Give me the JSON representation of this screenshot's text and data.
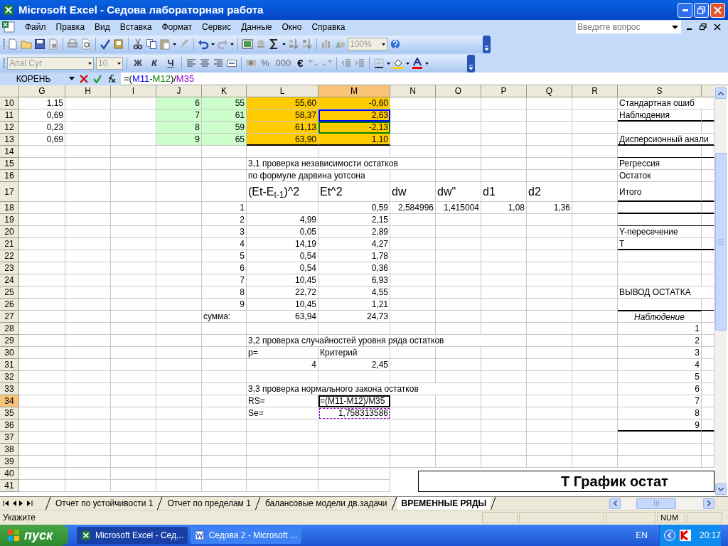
{
  "window": {
    "title": "Microsoft Excel - Седова лабораторная работа"
  },
  "menu": [
    "Файл",
    "Правка",
    "Вид",
    "Вставка",
    "Формат",
    "Сервис",
    "Данные",
    "Окно",
    "Справка"
  ],
  "help_box": {
    "placeholder": "Введите вопрос"
  },
  "standard_toolbar": {
    "zoom": "100%"
  },
  "formatting_toolbar": {
    "font": "Arial Cyr",
    "size": "10",
    "style_buttons": [
      "Ж",
      "К",
      "Ч"
    ],
    "number_buttons": [
      "%",
      "000",
      "€"
    ]
  },
  "formula_bar": {
    "name_box": "КОРЕНЬ",
    "formula": [
      {
        "text": "=("
      },
      {
        "text": "M11",
        "color": "#0000ff"
      },
      {
        "text": "-"
      },
      {
        "text": "M12",
        "color": "#008000"
      },
      {
        "text": ")/"
      },
      {
        "text": "M35",
        "color": "#9900cc"
      }
    ]
  },
  "columns": [
    {
      "label": "G",
      "selected": false
    },
    {
      "label": "H",
      "selected": false
    },
    {
      "label": "I",
      "selected": false
    },
    {
      "label": "J",
      "selected": false
    },
    {
      "label": "K",
      "selected": false
    },
    {
      "label": "L",
      "selected": false
    },
    {
      "label": "M",
      "selected": true
    },
    {
      "label": "N",
      "selected": false
    },
    {
      "label": "O",
      "selected": false
    },
    {
      "label": "P",
      "selected": false
    },
    {
      "label": "Q",
      "selected": false
    },
    {
      "label": "R",
      "selected": false
    },
    {
      "label": "S",
      "selected": false
    }
  ],
  "rows": [
    {
      "label": "10",
      "selected": false,
      "cells": {
        "G": {
          "text": "1,15",
          "kind": "number"
        },
        "J": {
          "text": "6",
          "kind": "number",
          "color": "#ccffcc"
        },
        "K": {
          "text": "55",
          "kind": "number",
          "color": "#ccffcc"
        },
        "L": {
          "text": "55,60",
          "kind": "number",
          "color": "#ffcc00"
        },
        "M": {
          "text": "-0,60",
          "kind": "number",
          "color": "#ffcc00"
        },
        "S": {
          "text": "Стандартная ошиб",
          "kind": "text"
        }
      }
    },
    {
      "label": "11",
      "selected": false,
      "cells": {
        "G": {
          "text": "0,69",
          "kind": "number"
        },
        "J": {
          "text": "7",
          "kind": "number",
          "color": "#ccffcc"
        },
        "K": {
          "text": "61",
          "kind": "number",
          "color": "#ccffcc"
        },
        "L": {
          "text": "58,37",
          "kind": "number",
          "color": "#ffcc00"
        },
        "M": {
          "text": "2,63",
          "kind": "number",
          "color": "#ffcc00",
          "reference": {
            "color": "#0000ff",
            "dashed": false
          }
        },
        "S": {
          "text": "Наблюдения",
          "kind": "text",
          "border_below": true,
          "heavy": true
        }
      }
    },
    {
      "label": "12",
      "selected": false,
      "cells": {
        "G": {
          "text": "0,23",
          "kind": "number"
        },
        "J": {
          "text": "8",
          "kind": "number",
          "color": "#ccffcc"
        },
        "K": {
          "text": "59",
          "kind": "number",
          "color": "#ccffcc"
        },
        "L": {
          "text": "61,13",
          "kind": "number",
          "color": "#ffcc00"
        },
        "M": {
          "text": "-2,13",
          "kind": "number",
          "color": "#ffcc00",
          "reference": {
            "color": "#008000",
            "dashed": false
          }
        }
      }
    },
    {
      "label": "13",
      "selected": false,
      "cells": {
        "G": {
          "text": "0,69",
          "kind": "number"
        },
        "J": {
          "text": "9",
          "kind": "number",
          "color": "#ccffcc"
        },
        "K": {
          "text": "65",
          "kind": "number",
          "color": "#ccffcc"
        },
        "L": {
          "text": "63,90",
          "kind": "number",
          "color": "#ffcc00",
          "border_below": true,
          "heavy": true
        },
        "M": {
          "text": "1,10",
          "kind": "number",
          "color": "#ffcc00",
          "border_below": true,
          "heavy": true
        },
        "S": {
          "text": "Дисперсионный анали",
          "kind": "text",
          "border_below": true,
          "heavy": true
        }
      }
    },
    {
      "label": "14",
      "selected": false,
      "cells": {
        "S": {
          "border_below": true,
          "heavy": false
        }
      }
    },
    {
      "label": "15",
      "selected": false,
      "cells": {
        "L": {
          "text": "3,1 проверка независимости остатков",
          "kind": "text"
        },
        "S": {
          "text": "Регрессия",
          "kind": "text"
        }
      }
    },
    {
      "label": "16",
      "selected": false,
      "cells": {
        "L": {
          "text": "по формуле дарвина уотсона",
          "kind": "text"
        },
        "S": {
          "text": "Остаток",
          "kind": "text"
        }
      }
    },
    {
      "label": "17",
      "selected": false,
      "cells": {
        "L": {
          "text": "(Et-E$_{t-1}$)^2",
          "kind": "heading"
        },
        "M": {
          "text": "Et^2",
          "kind": "heading"
        },
        "N": {
          "text": "dw",
          "kind": "heading"
        },
        "O": {
          "text": "dw\"",
          "kind": "heading"
        },
        "P": {
          "text": "d1",
          "kind": "heading"
        },
        "Q": {
          "text": "d2",
          "kind": "heading"
        },
        "S": {
          "text": "Итого",
          "kind": "text",
          "border_below": true,
          "heavy": true
        }
      }
    },
    {
      "label": "18",
      "selected": false,
      "cells": {
        "K": {
          "text": "1",
          "kind": "number"
        },
        "M": {
          "text": "0,59",
          "kind": "number"
        },
        "N": {
          "text": "2,584996",
          "kind": "number"
        },
        "O": {
          "text": "1,415004",
          "kind": "number"
        },
        "P": {
          "text": "1,08",
          "kind": "number"
        },
        "Q": {
          "text": "1,36",
          "kind": "number"
        },
        "S": {
          "border_below": true,
          "heavy": true
        }
      }
    },
    {
      "label": "19",
      "selected": false,
      "cells": {
        "K": {
          "text": "2",
          "kind": "number"
        },
        "L": {
          "text": "4,99",
          "kind": "number"
        },
        "M": {
          "text": "2,15",
          "kind": "number"
        },
        "S": {
          "border_below": true,
          "heavy": false
        }
      }
    },
    {
      "label": "20",
      "selected": false,
      "cells": {
        "K": {
          "text": "3",
          "kind": "number"
        },
        "L": {
          "text": "0,05",
          "kind": "number"
        },
        "M": {
          "text": "2,89",
          "kind": "number"
        },
        "S": {
          "text": "Y-пересечение",
          "kind": "text"
        }
      }
    },
    {
      "label": "21",
      "selected": false,
      "cells": {
        "K": {
          "text": "4",
          "kind": "number"
        },
        "L": {
          "text": "14,19",
          "kind": "number"
        },
        "M": {
          "text": "4,27",
          "kind": "number"
        },
        "S": {
          "text": "T",
          "kind": "text",
          "border_below": true,
          "heavy": true
        }
      }
    },
    {
      "label": "22",
      "selected": false,
      "cells": {
        "K": {
          "text": "5",
          "kind": "number"
        },
        "L": {
          "text": "0,54",
          "kind": "number"
        },
        "M": {
          "text": "1,78",
          "kind": "number"
        }
      }
    },
    {
      "label": "23",
      "selected": false,
      "cells": {
        "K": {
          "text": "6",
          "kind": "number"
        },
        "L": {
          "text": "0,54",
          "kind": "number"
        },
        "M": {
          "text": "0,36",
          "kind": "number"
        }
      }
    },
    {
      "label": "24",
      "selected": false,
      "cells": {
        "K": {
          "text": "7",
          "kind": "number"
        },
        "L": {
          "text": "10,45",
          "kind": "number"
        },
        "M": {
          "text": "6,93",
          "kind": "number"
        }
      }
    },
    {
      "label": "25",
      "selected": false,
      "cells": {
        "K": {
          "text": "8",
          "kind": "number"
        },
        "L": {
          "text": "22,72",
          "kind": "number"
        },
        "M": {
          "text": "4,55",
          "kind": "number"
        },
        "S": {
          "text": "ВЫВОД ОСТАТКА",
          "kind": "text"
        }
      }
    },
    {
      "label": "26",
      "selected": false,
      "cells": {
        "K": {
          "text": "9",
          "kind": "number"
        },
        "L": {
          "text": "10,45",
          "kind": "number"
        },
        "M": {
          "text": "1,21",
          "kind": "number"
        },
        "S": {
          "border_below": true,
          "heavy": false
        }
      }
    },
    {
      "label": "27",
      "selected": false,
      "cells": {
        "K": {
          "text": "сумма:",
          "kind": "text"
        },
        "L": {
          "text": "63,94",
          "kind": "number"
        },
        "M": {
          "text": "24,73",
          "kind": "number"
        },
        "S": {
          "text": "Наблюдение",
          "kind": "caption"
        }
      }
    },
    {
      "label": "28",
      "selected": false,
      "cells": {
        "S": {
          "text": "1",
          "kind": "number"
        }
      }
    },
    {
      "label": "29",
      "selected": false,
      "cells": {
        "L": {
          "text": "3,2 проверка случайностей уровня ряда остатков",
          "kind": "text"
        },
        "S": {
          "text": "2",
          "kind": "number"
        }
      }
    },
    {
      "label": "30",
      "selected": false,
      "cells": {
        "L": {
          "text": "p=",
          "kind": "text"
        },
        "M": {
          "text": "Критерий",
          "kind": "text"
        },
        "S": {
          "text": "3",
          "kind": "number"
        }
      }
    },
    {
      "label": "31",
      "selected": false,
      "cells": {
        "L": {
          "text": "4",
          "kind": "number"
        },
        "M": {
          "text": "2,45",
          "kind": "number"
        },
        "S": {
          "text": "4",
          "kind": "number"
        }
      }
    },
    {
      "label": "32",
      "selected": false,
      "cells": {
        "S": {
          "text": "5",
          "kind": "number"
        }
      }
    },
    {
      "label": "33",
      "selected": false,
      "cells": {
        "L": {
          "text": "3,3 проверка нормального закона остатков",
          "kind": "text"
        },
        "S": {
          "text": "6",
          "kind": "number"
        }
      }
    },
    {
      "label": "34",
      "selected": true,
      "cells": {
        "L": {
          "text": "RS=",
          "kind": "text"
        },
        "M": {
          "text": "=(M11-M12)/M35",
          "kind": "editing"
        },
        "S": {
          "text": "7",
          "kind": "number"
        }
      }
    },
    {
      "label": "35",
      "selected": false,
      "cells": {
        "L": {
          "text": "Se=",
          "kind": "text"
        },
        "M": {
          "text": "1,758313586",
          "kind": "number",
          "reference": {
            "color": "#9900cc",
            "dashed": true
          }
        },
        "S": {
          "text": "8",
          "kind": "number"
        }
      }
    },
    {
      "label": "36",
      "selected": false,
      "cells": {
        "S": {
          "text": "9",
          "kind": "number",
          "border_below": true,
          "heavy": true
        }
      }
    },
    {
      "label": "37",
      "selected": false,
      "cells": {}
    },
    {
      "label": "38",
      "selected": false,
      "cells": {}
    },
    {
      "label": "39",
      "selected": false,
      "cells": {}
    },
    {
      "label": "40",
      "selected": false,
      "cells": {}
    },
    {
      "label": "41",
      "selected": false,
      "cells": {}
    }
  ],
  "chart": {
    "title": "Т График остат"
  },
  "sheet_tabs": [
    {
      "label": "Отчет по устойчивости 1",
      "selected": false
    },
    {
      "label": "Отчет по пределам 1",
      "selected": false
    },
    {
      "label": "балансовые модели дв.задачи",
      "selected": false
    },
    {
      "label": "ВРЕМЕННЫЕ РЯДЫ",
      "selected": true
    }
  ],
  "status_bar": {
    "text": "Укажите",
    "indicator": "NUM"
  },
  "taskbar": {
    "start": "пуск",
    "tasks": [
      {
        "label": "Microsoft Excel - Сед...",
        "selected": true
      },
      {
        "label": "Седова 2 - Microsoft ...",
        "selected": false
      }
    ],
    "language": "EN",
    "clock": "20:17"
  }
}
